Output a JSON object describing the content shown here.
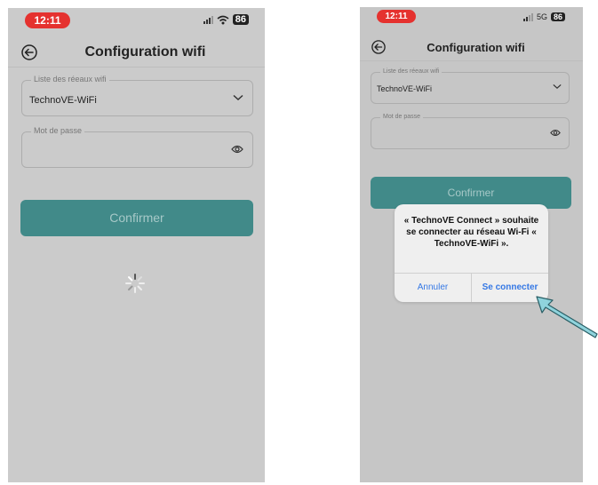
{
  "phone1": {
    "status": {
      "time": "12:11",
      "battery": "86"
    },
    "header": {
      "title": "Configuration wifi"
    },
    "network_select": {
      "label": "Liste des réeaux wifi",
      "value": "TechnoVE-WiFi"
    },
    "password": {
      "label": "Mot de passe",
      "value": ""
    },
    "confirm_label": "Confirmer"
  },
  "phone2": {
    "status": {
      "time": "12:11",
      "network": "5G",
      "battery": "86"
    },
    "header": {
      "title": "Configuration wifi"
    },
    "network_select": {
      "label": "Liste des réeaux wifi",
      "value": "TechnoVE-WiFi"
    },
    "password": {
      "label": "Mot de passe",
      "value": ""
    },
    "confirm_label": "Confirmer",
    "alert": {
      "message": "« TechnoVE Connect » souhaite se connecter au réseau Wi-Fi « TechnoVE-WiFi ».",
      "cancel_label": "Annuler",
      "connect_label": "Se connecter"
    }
  },
  "colors": {
    "accent": "#418a89",
    "status_pill": "#e5322f",
    "alert_link": "#3578e5",
    "arrow": "#8fd3dc"
  },
  "icons": [
    "back-arrow-icon",
    "chevron-down-icon",
    "eye-icon",
    "wifi-icon",
    "signal-icon",
    "battery-icon",
    "loading-spinner-icon",
    "pointer-arrow-icon"
  ]
}
